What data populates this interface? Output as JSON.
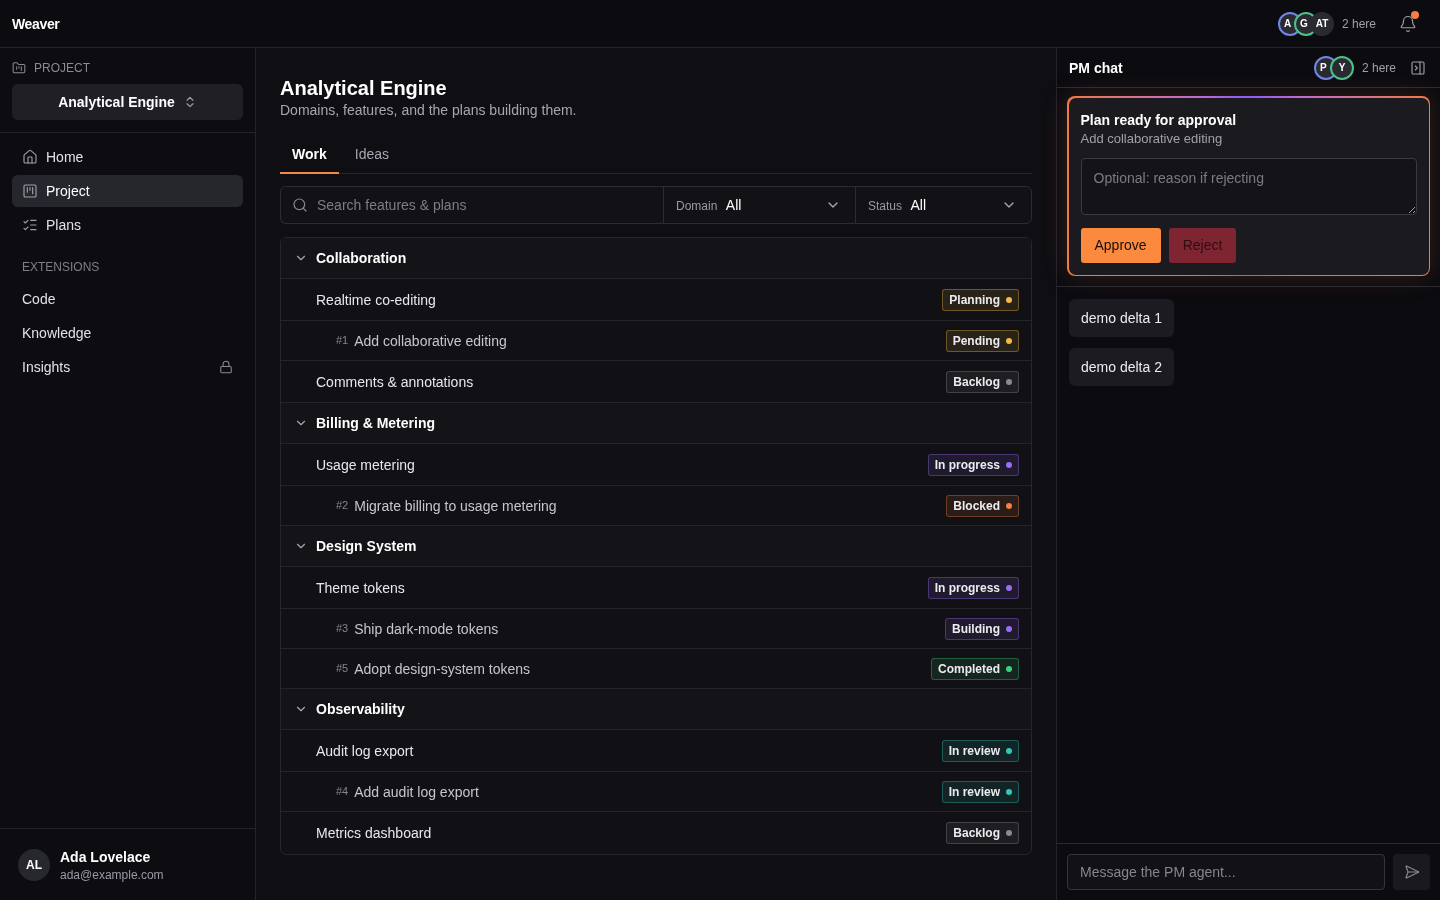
{
  "top_bar": {
    "title": "Weaver",
    "presence": {
      "avatars": [
        {
          "initials": "A",
          "color": "#6f86e8"
        },
        {
          "initials": "G",
          "color": "#4cc08a"
        },
        {
          "initials": "AT"
        }
      ],
      "count": "2 here"
    },
    "notifications": {
      "unread": true
    }
  },
  "sidebar": {
    "section_label": "PROJECT",
    "project_selector": "Analytical Engine",
    "nav": [
      {
        "label": "Home",
        "kind": "home",
        "selected": false
      },
      {
        "label": "Project",
        "kind": "board",
        "selected": true
      },
      {
        "label": "Plans",
        "kind": "checklist",
        "selected": false
      }
    ],
    "extensions_label": "EXTENSIONS",
    "extensions": [
      {
        "label": "Code",
        "selected": false,
        "locked": false
      },
      {
        "label": "Knowledge",
        "selected": false,
        "locked": false
      },
      {
        "label": "Insights",
        "selected": false,
        "locked": true
      }
    ],
    "user": {
      "initials": "AL",
      "name": "Ada Lovelace",
      "email": "ada@example.com"
    }
  },
  "main": {
    "title": "Analytical Engine",
    "subtitle": "Domains, features, and the plans building them.",
    "tabs": [
      {
        "label": "Work",
        "selected": true
      },
      {
        "label": "Ideas",
        "selected": false
      }
    ],
    "search": {
      "placeholder": "Search features & plans"
    },
    "filters": [
      {
        "label": "Domain",
        "value": "All"
      },
      {
        "label": "Status",
        "value": "All"
      }
    ],
    "domains": [
      {
        "name": "Collaboration",
        "expanded": true,
        "children": [
          {
            "name": "Realtime co-editing",
            "status": {
              "label": "Planning",
              "color": "#f5b93f"
            },
            "children": [
              {
                "number": "#1",
                "name": "Add collaborative editing",
                "status": {
                  "label": "Pending",
                  "color": "#f5b93f"
                }
              }
            ]
          },
          {
            "name": "Comments & annotations",
            "status": {
              "label": "Backlog",
              "color": "#8a8a90"
            }
          }
        ]
      },
      {
        "name": "Billing & Metering",
        "expanded": true,
        "children": [
          {
            "name": "Usage metering",
            "status": {
              "label": "In progress",
              "color": "#9b6cf6"
            },
            "children": [
              {
                "number": "#2",
                "name": "Migrate billing to usage metering",
                "status": {
                  "label": "Blocked",
                  "color": "#f97d3c"
                }
              }
            ]
          }
        ]
      },
      {
        "name": "Design System",
        "expanded": true,
        "children": [
          {
            "name": "Theme tokens",
            "status": {
              "label": "In progress",
              "color": "#9b6cf6"
            },
            "children": [
              {
                "number": "#3",
                "name": "Ship dark-mode tokens",
                "status": {
                  "label": "Building",
                  "color": "#9b6cf6"
                }
              },
              {
                "number": "#5",
                "name": "Adopt design-system tokens",
                "status": {
                  "label": "Completed",
                  "color": "#3ccf7e"
                }
              }
            ]
          }
        ]
      },
      {
        "name": "Observability",
        "expanded": true,
        "children": [
          {
            "name": "Audit log export",
            "status": {
              "label": "In review",
              "color": "#2ec9b8"
            },
            "children": [
              {
                "number": "#4",
                "name": "Add audit log export",
                "status": {
                  "label": "In review",
                  "color": "#2ec9b8"
                }
              }
            ]
          },
          {
            "name": "Metrics dashboard",
            "status": {
              "label": "Backlog",
              "color": "#8a8a90"
            }
          }
        ]
      }
    ]
  },
  "chat": {
    "title": "PM chat",
    "presence": {
      "avatars": [
        {
          "initials": "P",
          "color": "#6f86e8"
        },
        {
          "initials": "Y",
          "color": "#4cc08a"
        }
      ],
      "count": "2 here"
    },
    "approval": {
      "title": "Plan ready for approval",
      "subtitle": "Add collaborative editing",
      "reason_placeholder": "Optional: reason if rejecting",
      "buttons": [
        {
          "label": "Approve",
          "kind": "approve"
        },
        {
          "label": "Reject",
          "kind": "reject"
        }
      ]
    },
    "messages": [
      "demo delta 1",
      "demo delta 2"
    ],
    "composer": {
      "placeholder": "Message the PM agent..."
    }
  }
}
